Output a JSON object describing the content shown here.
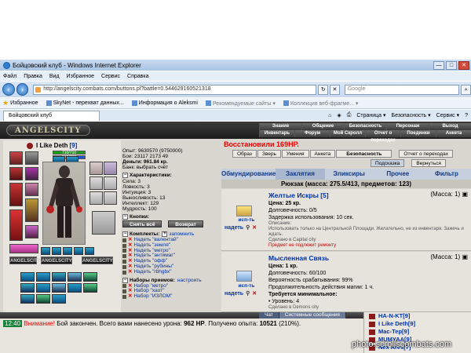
{
  "window": {
    "title": "Бойцовский клуб - Windows Internet Explorer"
  },
  "menu": [
    "Файл",
    "Правка",
    "Вид",
    "Избранное",
    "Сервис",
    "Справка"
  ],
  "address": {
    "url": "http://angelscity.combats.com/buttons.pl?battle=0.544629160521318"
  },
  "search": {
    "placeholder": "Google"
  },
  "favorites": {
    "label": "Избранное",
    "items": [
      "SkyNet - перехват данных...",
      "Информация о Aleksmi",
      "Рекомендуемые сайты ▾",
      "Коллекция веб-фрагме... ▾"
    ]
  },
  "tab": {
    "title": "Бойцовский клуб"
  },
  "commandbar": [
    "Страница ▾",
    "Безопасность ▾",
    "Сервис ▾"
  ],
  "game": {
    "logo": "ANGELSCITY",
    "nav_row1": [
      "Знание",
      "Общение",
      "Безопасность",
      "Персонаж",
      "Выход"
    ],
    "nav_row2": [
      "Инвентарь",
      "Форум",
      "Мой Скролл",
      "Отчет о переходах",
      "Поединки",
      "Анкета"
    ]
  },
  "character": {
    "name": "I Like Deth",
    "level": "[9]",
    "hp_bar": "710/710",
    "mp_bar": "150/700"
  },
  "stats": {
    "exp": "Опыт: 9630570 (9750000)",
    "fights": "Бои: 23117  2173  49",
    "money": "Деньги: 961.84 кр.",
    "bank": "Банк: выбрать счёт",
    "chars_header": "Характеристики:",
    "chars": [
      "Сила: 3",
      "Ловкость: 3",
      "Интуиция: 3",
      "Выносливость: 13",
      "Интеллект: 129",
      "Мудрость: 100"
    ],
    "buttons_header": "Кнопки:",
    "btn_remove_all": "Снять всё",
    "btn_return": "Возврат",
    "kits_header": "Комплекты:",
    "kits_link": "запомнить",
    "kits": [
      "Надеть \"валентай\"",
      "Надеть \"земля\"",
      "Надеть \"метро\"",
      "Надеть \"антимаг\"",
      "Надеть \"офф\"",
      "Надеть \"рубины\"",
      "Надеть \"rbhgbx\""
    ],
    "sets_header": "Наборы приемов:",
    "sets_link": "настроить",
    "sets": [
      "Набор \"метро\"",
      "Набор \"хаот\"",
      "Набор \"ИЗЛОМ\""
    ]
  },
  "right": {
    "restore": "Восстановили 169HP.",
    "buttons": [
      "Образ",
      "Зверь",
      "Умения",
      "Анкета",
      "Безопасность",
      "Отчет о переходах"
    ],
    "buttons2": [
      "Подсказка",
      "Вернуться"
    ],
    "tabs": [
      "Обмундирование",
      "Заклятия",
      "Эликсиры",
      "Прочее",
      "Фильтр"
    ],
    "backpack": "Рюкзак (масса: 275.5/413, предметов: 123)"
  },
  "items": [
    {
      "use": "исп-ть",
      "wear": "надеть",
      "name": "Желтые Искры [5]",
      "mass": "(Масса: 1)",
      "price": "Цена: 25 кр.",
      "durability": "Долговечность: 0/5",
      "delay": "Задержка использования: 10 сек.",
      "desc_label": "Описание:",
      "desc": "Использовать только на Центральной Площади. Желательно, не из инвентаря. Зажечь и ждать.",
      "made": "Сделано в Capital city",
      "warn": "Предмет не подлежит ремонту"
    },
    {
      "use": "исп-ть",
      "wear": "надеть",
      "name": "Мысленная Связь",
      "mass": "(Масса: 1)",
      "price": "Цена: 1 кр.",
      "durability": "Долговечность: 60/100",
      "chance": "Вероятность срабатывания: 99%",
      "duration": "Продолжительность действия магии: 1 ч.",
      "req": "Требуется минимальное:",
      "req_level": "• Уровень: 4",
      "made": "Сделано в Demons city"
    }
  ],
  "chat": {
    "tabs": [
      "Чат",
      "Системные сообщения"
    ],
    "time": "12:40",
    "warn": "Внимание!",
    "text_a": " Бой закончен. Всего вами нанесено урона: ",
    "dmg": "962 HP",
    "text_b": ". Получено опыта: ",
    "exp": "10521",
    "text_c": " (210%)."
  },
  "online": [
    "HA-N-KT[9]",
    "I Like Deth[9]",
    "Mac-Тер[9]",
    "MUMYAA[9]",
    "Nex Ares[7]"
  ],
  "watermark": "photo.scrollscombats.com",
  "colors": {
    "accent_blue": "#0033aa",
    "alert_red": "#e00000",
    "hp_green": "#1a9e1a",
    "mp_blue": "#2255cc"
  }
}
